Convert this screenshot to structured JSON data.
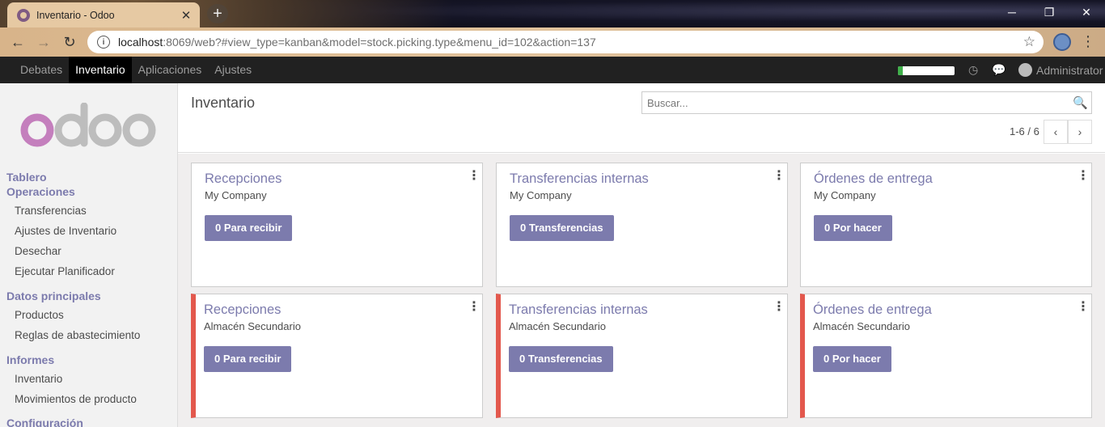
{
  "browser": {
    "tab_title": "Inventario - Odoo",
    "new_tab_label": "+",
    "url_host": "localhost",
    "url_rest": ":8069/web?#view_type=kanban&model=stock.picking.type&menu_id=102&action=137",
    "icons": {
      "back": "←",
      "forward": "→",
      "reload": "↻",
      "info": "i",
      "star": "☆",
      "menu": "⋮",
      "close": "✕",
      "minimize": "─",
      "restore": "❐",
      "win_close": "✕"
    }
  },
  "topbar": {
    "menu": [
      {
        "label": "Debates",
        "active": false
      },
      {
        "label": "Inventario",
        "active": true
      },
      {
        "label": "Aplicaciones",
        "active": false
      },
      {
        "label": "Ajustes",
        "active": false
      }
    ],
    "progress_fraction": 0.08,
    "progress_color": "#3fb04a",
    "clock_icon": "◷",
    "chat_icon": "💬",
    "user_name": "Administrator"
  },
  "sidebar": {
    "logo_text": "odoo",
    "sections": [
      {
        "title": "Tablero"
      },
      {
        "title": "Operaciones",
        "items": [
          "Transferencias",
          "Ajustes de Inventario",
          "Desechar",
          "Ejecutar Planificador"
        ]
      },
      {
        "title": "Datos principales",
        "items": [
          "Productos",
          "Reglas de abastecimiento"
        ]
      },
      {
        "title": "Informes",
        "items": [
          "Inventario",
          "Movimientos de producto"
        ]
      },
      {
        "title": "Configuración"
      }
    ]
  },
  "control_panel": {
    "breadcrumb": "Inventario",
    "search_placeholder": "Buscar...",
    "search_icon": "🔍",
    "pager": "1-6 / 6",
    "prev_icon": "‹",
    "next_icon": "›"
  },
  "kanban": {
    "accent": "#7c7bad",
    "alert_color": "#e3584d",
    "cards": [
      {
        "title": "Recepciones",
        "company": "My Company",
        "button": "0 Para recibir",
        "alert": false
      },
      {
        "title": "Transferencias internas",
        "company": "My Company",
        "button": "0 Transferencias",
        "alert": false
      },
      {
        "title": "Órdenes de entrega",
        "company": "My Company",
        "button": "0 Por hacer",
        "alert": false
      },
      {
        "title": "Recepciones",
        "company": "Almacén Secundario",
        "button": "0 Para recibir",
        "alert": true
      },
      {
        "title": "Transferencias internas",
        "company": "Almacén Secundario",
        "button": "0 Transferencias",
        "alert": true
      },
      {
        "title": "Órdenes de entrega",
        "company": "Almacén Secundario",
        "button": "0 Por hacer",
        "alert": true
      }
    ]
  }
}
